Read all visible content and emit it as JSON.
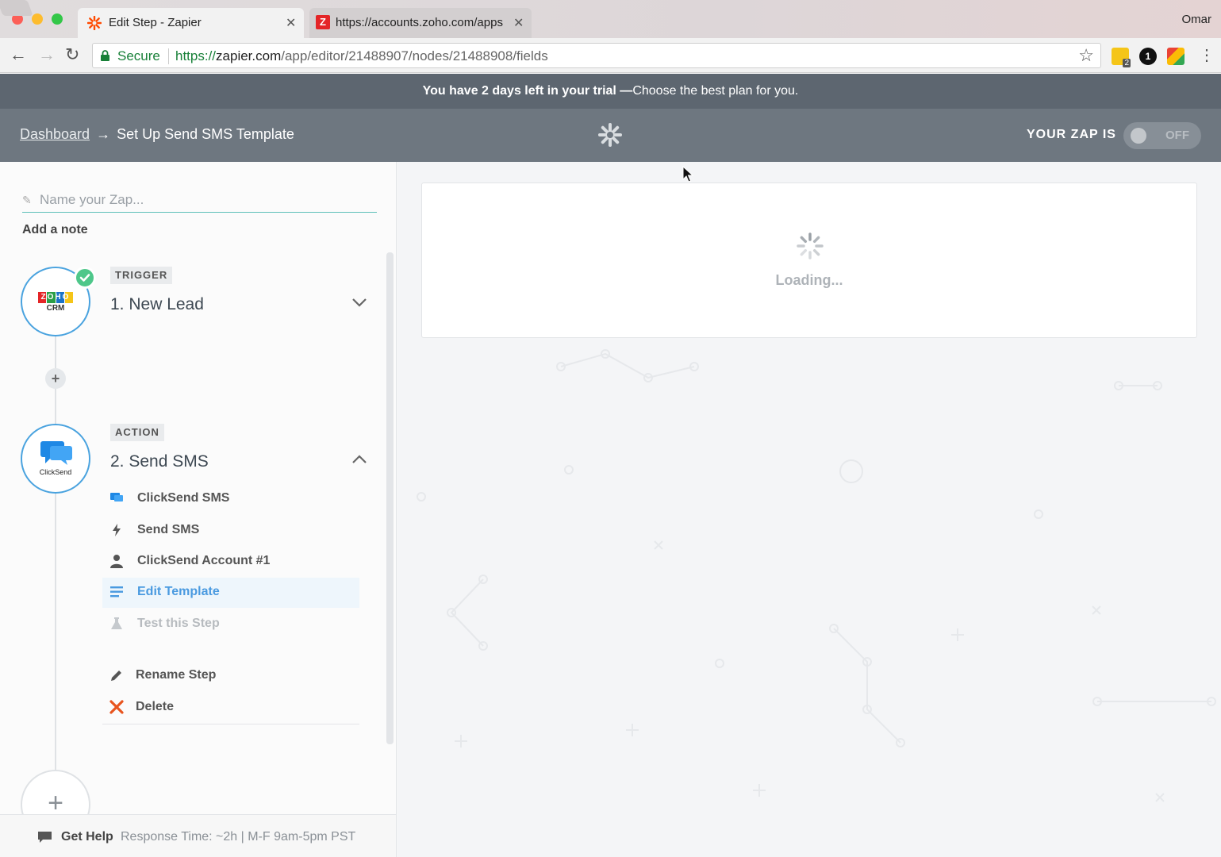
{
  "browser": {
    "tabs": [
      {
        "title": "Edit Step - Zapier",
        "active": true
      },
      {
        "title": "https://accounts.zoho.com/apps",
        "active": false
      }
    ],
    "profile_name": "Omar",
    "secure_label": "Secure",
    "url_scheme": "https://",
    "url_host": "zapier.com",
    "url_path": "/app/editor/21488907/nodes/21488908/fields",
    "extension_badge": "2",
    "extension_count": "1"
  },
  "banner": {
    "strong_text": "You have 2 days left in your trial —",
    "link_text": "Choose the best plan for you."
  },
  "header": {
    "dashboard_link": "Dashboard",
    "arrow": "→",
    "page_title": "Set Up Send SMS Template",
    "zap_status_label": "YOUR ZAP IS",
    "toggle_state": "OFF"
  },
  "sidebar": {
    "zap_name_placeholder": "Name your Zap...",
    "add_note": "Add a note",
    "trigger": {
      "tag": "TRIGGER",
      "title": "1. New Lead",
      "app_logo_word": "ZOHO",
      "app_logo_sub": "CRM"
    },
    "action": {
      "tag": "ACTION",
      "title": "2. Send SMS",
      "app_logo_word": "ClickSend",
      "items": [
        {
          "label": "ClickSend SMS",
          "icon": "clicksend-icon",
          "state": "normal"
        },
        {
          "label": "Send SMS",
          "icon": "bolt-icon",
          "state": "normal"
        },
        {
          "label": "ClickSend Account #1",
          "icon": "user-icon",
          "state": "normal"
        },
        {
          "label": "Edit Template",
          "icon": "lines-icon",
          "state": "active"
        },
        {
          "label": "Test this Step",
          "icon": "flask-icon",
          "state": "disabled"
        }
      ],
      "rename_label": "Rename Step",
      "delete_label": "Delete"
    },
    "help": {
      "label": "Get Help",
      "meta": "Response Time: ~2h | M-F 9am-5pm PST"
    }
  },
  "main": {
    "loading_text": "Loading..."
  },
  "colors": {
    "accent_blue": "#4aa3df",
    "success_green": "#4ec78a",
    "delete_red": "#e8541e",
    "header_bg": "#6e7780",
    "banner_bg": "#5d6670"
  }
}
